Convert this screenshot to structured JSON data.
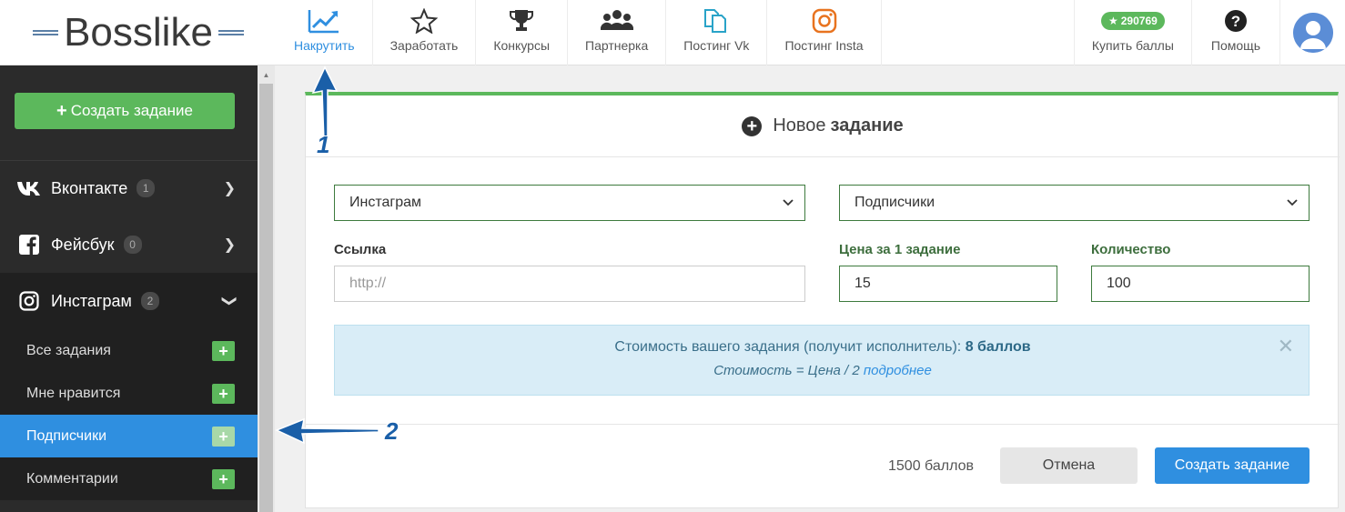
{
  "logo": {
    "brand_prefix": "Boss",
    "brand_suffix": "like"
  },
  "nav": {
    "items": [
      {
        "label": "Накрутить",
        "icon": "chart-line-icon",
        "active": true
      },
      {
        "label": "Заработать",
        "icon": "star-outline-icon"
      },
      {
        "label": "Конкурсы",
        "icon": "trophy-icon"
      },
      {
        "label": "Партнерка",
        "icon": "users-icon"
      },
      {
        "label": "Постинг Vk",
        "icon": "copy-files-icon"
      },
      {
        "label": "Постинг Insta",
        "icon": "instagram-icon"
      }
    ],
    "balance": "290769",
    "buy_label": "Купить баллы",
    "help_label": "Помощь"
  },
  "sidebar": {
    "create_label": "Создать задание",
    "networks": [
      {
        "label": "Вконтакте",
        "count": "1",
        "icon": "vk-icon"
      },
      {
        "label": "Фейсбук",
        "count": "0",
        "icon": "facebook-icon"
      },
      {
        "label": "Инстаграм",
        "count": "2",
        "icon": "instagram-icon"
      }
    ],
    "sub_items": [
      {
        "label": "Все задания"
      },
      {
        "label": "Мне нравится"
      },
      {
        "label": "Подписчики",
        "active": true
      },
      {
        "label": "Комментарии"
      }
    ]
  },
  "task": {
    "title_prefix": "Новое",
    "title_bold": "задание",
    "network_select": "Инстаграм",
    "type_select": "Подписчики",
    "link_label": "Ссылка",
    "link_placeholder": "http://",
    "price_label": "Цена за 1 задание",
    "price_value": "15",
    "qty_label": "Количество",
    "qty_value": "100",
    "info_line1": "Стоимость вашего задания (получит исполнитель):",
    "info_line1_bold": "8 баллов",
    "info_line2": "Стоимость = Цена / 2",
    "info_link": "подробнее",
    "total": "1500 баллов",
    "cancel_label": "Отмена",
    "submit_label": "Создать задание"
  },
  "annotations": {
    "one": "1",
    "two": "2"
  },
  "colors": {
    "accent_blue": "#2f8fe0",
    "green": "#5cb85c",
    "sidebar_bg": "#2b2b2b",
    "info_bg": "#d9edf7"
  }
}
